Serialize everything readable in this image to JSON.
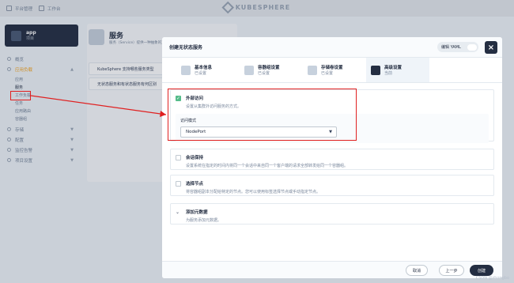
{
  "topbar": {
    "platform_label": "平台管理",
    "workbench_label": "工作台",
    "brand": "KUBESPHERE"
  },
  "sidebar": {
    "project_name": "app",
    "project_type": "项目",
    "items": [
      {
        "label": "概览"
      },
      {
        "label": "应用负载",
        "sub": [
          "应用",
          "服务",
          "工作负载",
          "任务",
          "应用路由",
          "容器组"
        ]
      },
      {
        "label": "存储"
      },
      {
        "label": "配置"
      },
      {
        "label": "监控告警"
      },
      {
        "label": "项目设置"
      }
    ]
  },
  "background": {
    "title": "服务",
    "subtitle": "服务（Service）提供一种抽象的方法...",
    "rows": [
      "KubeSphere 支持哪些服务类型",
      "无状态服务和有状态服务有何区别"
    ]
  },
  "modal": {
    "title": "创建无状态服务",
    "yaml_label": "编辑 YAML",
    "close_icon": "close-icon",
    "steps": [
      {
        "label": "基本信息",
        "status": "已设置"
      },
      {
        "label": "容器组设置",
        "status": "已设置"
      },
      {
        "label": "存储卷设置",
        "status": "已设置"
      },
      {
        "label": "高级设置",
        "status": "当前"
      }
    ],
    "sections": [
      {
        "title": "外部访问",
        "desc": "设置从集群外访问服务的方式。",
        "checked": true
      },
      {
        "title": "会话保持",
        "desc": "设置系统在指定的时间内将同一个会话中来自同一个客户端的请求全部转发给同一个容器组。",
        "checked": false
      },
      {
        "title": "选择节点",
        "desc": "将容器组副本分配给特定的节点。您可以使用标签选择节点或手动指定节点。",
        "checked": false
      },
      {
        "title": "添加元数据",
        "desc": "为服务添加元数据。",
        "checked": false
      }
    ],
    "access_mode_label": "访问模式",
    "access_mode_value": "NodePort",
    "buttons": {
      "cancel": "取消",
      "prev": "上一步",
      "create": "创建"
    }
  },
  "watermark": "CSDN @zhongbo"
}
